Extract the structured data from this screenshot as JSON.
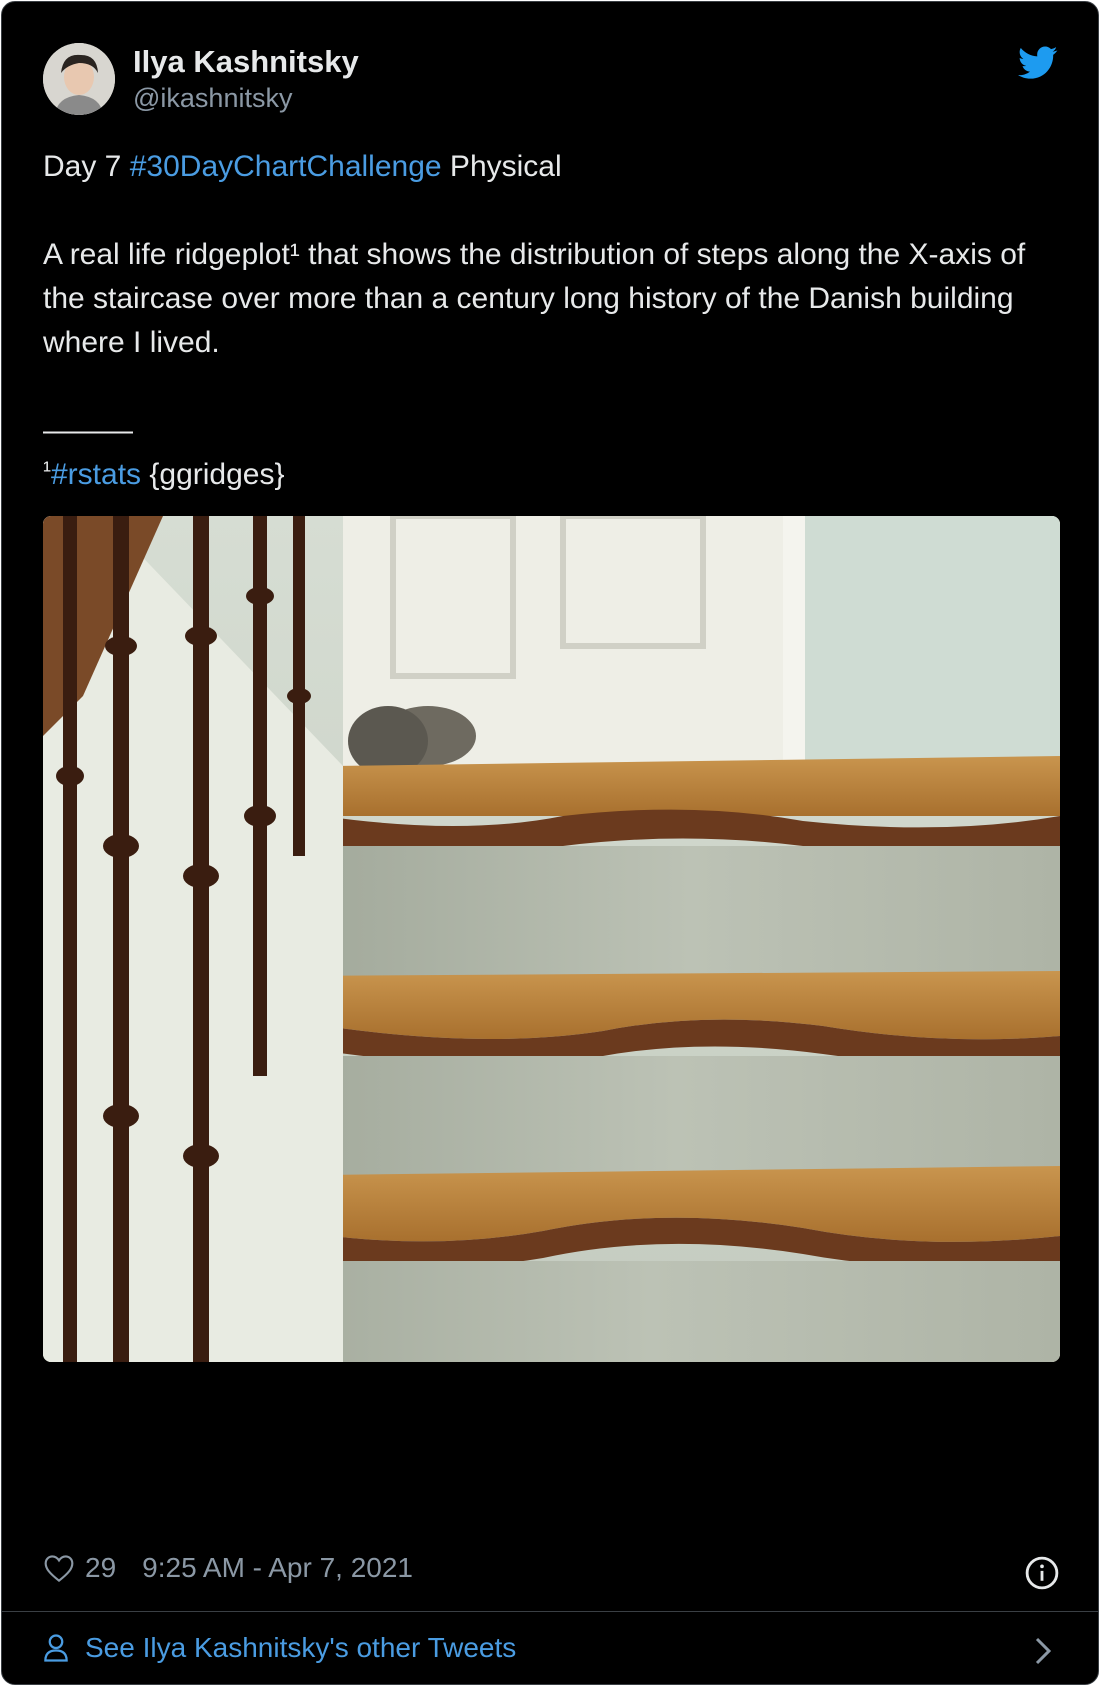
{
  "author": {
    "name": "Ilya Kashnitsky",
    "handle": "@ikashnitsky"
  },
  "tweet": {
    "line1_prefix": "Day 7 ",
    "line1_hashtag": "#30DayChartChallenge",
    "line1_suffix": " Physical",
    "body": "A real life ridgeplot¹ that shows the distribution of steps along the X-axis of the staircase over more than a century long history of the Danish building where I lived.",
    "separator": "———",
    "footnote_mark": "¹",
    "footnote_hashtag": "#rstats",
    "footnote_suffix": " {ggridges}"
  },
  "footer": {
    "likes": "29",
    "timestamp": "9:25 AM - Apr 7, 2021",
    "see_more": "See Ilya Kashnitsky's other Tweets"
  },
  "icons": {
    "brand": "twitter-bird-icon",
    "like": "heart-icon",
    "info": "info-icon",
    "profile": "person-icon",
    "chevron": "chevron-right-icon"
  },
  "colors": {
    "background": "#000000",
    "text": "#e7e9ea",
    "muted": "#8b98a5",
    "link": "#4a9ce2",
    "twitter_blue": "#1d9bf0"
  }
}
